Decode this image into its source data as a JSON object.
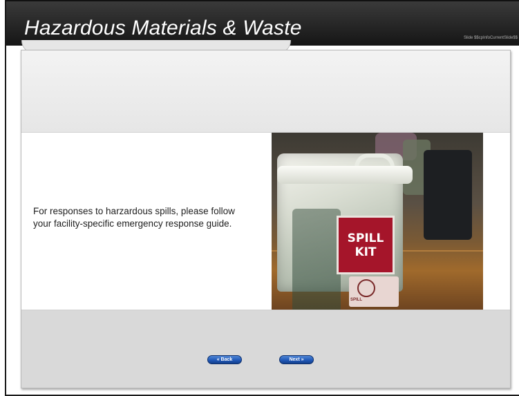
{
  "header": {
    "title": "Hazardous Materials & Waste",
    "slide_indicator": "Slide $$cpInfoCurrentSlide$$"
  },
  "content": {
    "text": "For responses to harzardous spills, please follow your facility-specific emergency response guide.",
    "image": {
      "label_text": "SPILL KIT",
      "small_label_text": "SPILL",
      "description_icon": "biohazard-icon"
    }
  },
  "navigation": {
    "back_label": "« Back",
    "next_label": "Next »"
  },
  "colors": {
    "header_bg": "#262626",
    "panel_bg": "#e3e3e3",
    "button_blue": "#2159b8",
    "spill_label_red": "#a5152a"
  }
}
